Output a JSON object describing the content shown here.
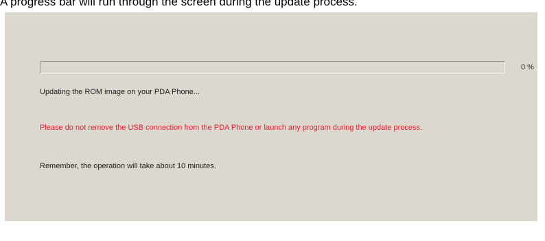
{
  "caption": "A progress bar will run through the screen during the update process.",
  "progress": {
    "percent_label": "0 %",
    "value": 0
  },
  "status_text": "Updating the ROM image on your PDA Phone...",
  "warning_text": "Please do not remove the USB connection from the PDA Phone or launch any program during the update process.",
  "remember_text": "Remember, the operation will take about 10 minutes.",
  "colors": {
    "panel_background": "#dcd8d0",
    "warning": "#e8192c",
    "text": "#222222"
  }
}
